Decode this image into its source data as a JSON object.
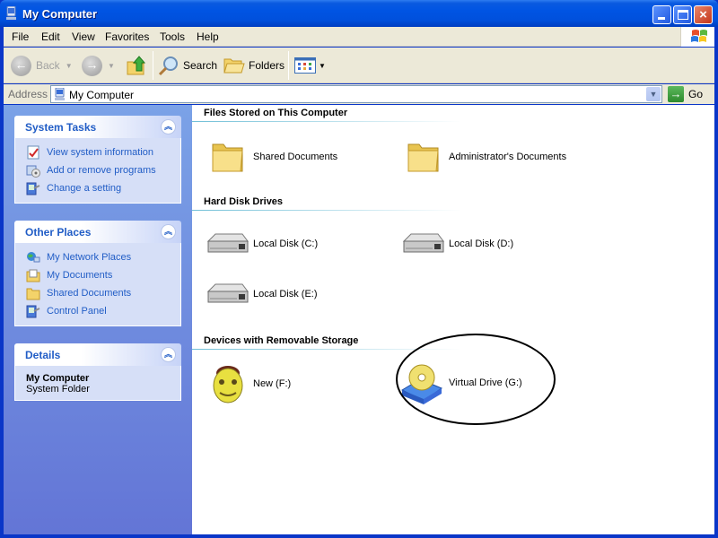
{
  "window": {
    "title": "My Computer",
    "controls": {
      "minimize": "minimize",
      "maximize": "maximize",
      "close": "×"
    }
  },
  "menubar": {
    "items": [
      {
        "label": "File",
        "accel": "F"
      },
      {
        "label": "Edit",
        "accel": "E"
      },
      {
        "label": "View",
        "accel": "V"
      },
      {
        "label": "Favorites",
        "accel": "a"
      },
      {
        "label": "Tools",
        "accel": "T"
      },
      {
        "label": "Help",
        "accel": "H"
      }
    ]
  },
  "toolbar": {
    "back_label": "Back",
    "forward_label": "",
    "up_label": "",
    "search_label": "Search",
    "folders_label": "Folders",
    "views_label": ""
  },
  "address": {
    "label": "Address",
    "value": "My Computer",
    "go_label": "Go"
  },
  "sidebar": {
    "system_tasks": {
      "title": "System Tasks",
      "items": [
        {
          "label": "View system information",
          "icon": "system-info-icon"
        },
        {
          "label": "Add or remove programs",
          "icon": "add-remove-programs-icon"
        },
        {
          "label": "Change a setting",
          "icon": "control-panel-icon"
        }
      ]
    },
    "other_places": {
      "title": "Other Places",
      "items": [
        {
          "label": "My Network Places",
          "icon": "network-places-icon"
        },
        {
          "label": "My Documents",
          "icon": "my-documents-icon"
        },
        {
          "label": "Shared Documents",
          "icon": "folder-icon"
        },
        {
          "label": "Control Panel",
          "icon": "control-panel-icon"
        }
      ]
    },
    "details": {
      "title": "Details",
      "name": "My Computer",
      "type": "System Folder"
    }
  },
  "content": {
    "groups": [
      {
        "title": "Files Stored on This Computer",
        "items": [
          {
            "label": "Shared Documents",
            "icon": "folder-icon"
          },
          {
            "label": "Administrator's Documents",
            "icon": "folder-icon"
          }
        ]
      },
      {
        "title": "Hard Disk Drives",
        "items": [
          {
            "label": "Local Disk (C:)",
            "icon": "hard-disk-icon"
          },
          {
            "label": "Local Disk (D:)",
            "icon": "hard-disk-icon"
          },
          {
            "label": "Local Disk (E:)",
            "icon": "hard-disk-icon"
          }
        ]
      },
      {
        "title": "Devices with Removable Storage",
        "items": [
          {
            "label": "New (F:)",
            "icon": "custom-drive-face-icon"
          },
          {
            "label": "Virtual Drive (G:)",
            "icon": "virtual-cd-drive-icon"
          }
        ]
      }
    ]
  }
}
